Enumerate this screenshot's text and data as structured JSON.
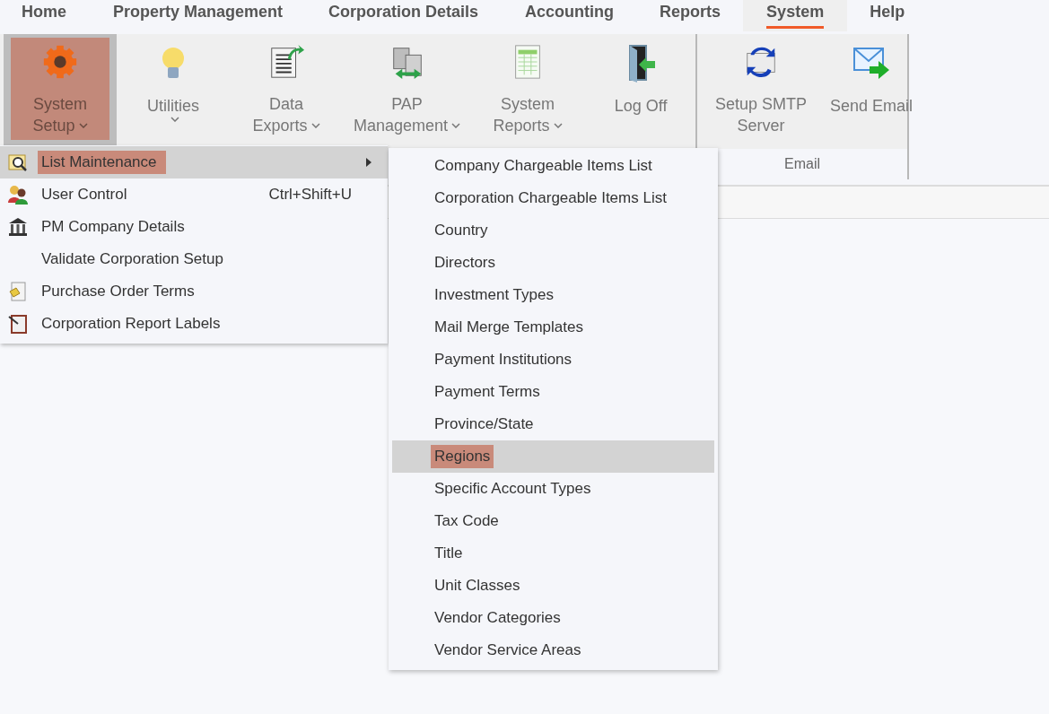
{
  "tabs": [
    {
      "label": "Home",
      "selected": false
    },
    {
      "label": "Property Management",
      "selected": false
    },
    {
      "label": "Corporation Details",
      "selected": false
    },
    {
      "label": "Accounting",
      "selected": false
    },
    {
      "label": "Reports",
      "selected": false
    },
    {
      "label": "System",
      "selected": true
    },
    {
      "label": "Help",
      "selected": false
    }
  ],
  "ribbon": {
    "groups": [
      {
        "buttons": [
          {
            "lines": [
              "System",
              "Setup"
            ],
            "dropdown": true,
            "selected": true
          },
          {
            "lines": [
              "Utilities"
            ],
            "dropdown": true,
            "selected": false
          },
          {
            "lines": [
              "Data",
              "Exports"
            ],
            "dropdown": true,
            "selected": false
          },
          {
            "lines": [
              "PAP",
              "Management"
            ],
            "dropdown": true,
            "selected": false
          },
          {
            "lines": [
              "System",
              "Reports"
            ],
            "dropdown": true,
            "selected": false
          },
          {
            "lines": [
              "Log Off"
            ],
            "dropdown": false,
            "selected": false
          }
        ]
      },
      {
        "label": "Email",
        "buttons": [
          {
            "lines": [
              "Setup SMTP",
              "Server"
            ],
            "dropdown": false,
            "selected": false
          },
          {
            "lines": [
              "Send Email"
            ],
            "dropdown": false,
            "selected": false
          }
        ]
      }
    ]
  },
  "menu": {
    "items": [
      {
        "label": "List Maintenance",
        "submenu": true,
        "selected": true
      },
      {
        "label": "User Control",
        "shortcut": "Ctrl+Shift+U",
        "submenu": false,
        "selected": false
      },
      {
        "label": "PM Company Details",
        "submenu": false,
        "selected": false
      },
      {
        "label": "Validate Corporation Setup",
        "submenu": false,
        "selected": false
      },
      {
        "label": "Purchase Order Terms",
        "submenu": false,
        "selected": false
      },
      {
        "label": "Corporation Report Labels",
        "submenu": false,
        "selected": false
      }
    ]
  },
  "submenu": {
    "items": [
      {
        "label": "Company Chargeable Items List",
        "selected": false
      },
      {
        "label": "Corporation Chargeable Items List",
        "selected": false
      },
      {
        "label": "Country",
        "selected": false
      },
      {
        "label": "Directors",
        "selected": false
      },
      {
        "label": "Investment Types",
        "selected": false
      },
      {
        "label": "Mail Merge Templates",
        "selected": false
      },
      {
        "label": "Payment Institutions",
        "selected": false
      },
      {
        "label": "Payment Terms",
        "selected": false
      },
      {
        "label": "Province/State",
        "selected": false
      },
      {
        "label": "Regions",
        "selected": true
      },
      {
        "label": "Specific Account Types",
        "selected": false
      },
      {
        "label": "Tax Code",
        "selected": false
      },
      {
        "label": "Title",
        "selected": false
      },
      {
        "label": "Unit Classes",
        "selected": false
      },
      {
        "label": "Vendor Categories",
        "selected": false
      },
      {
        "label": "Vendor Service Areas",
        "selected": false
      }
    ]
  }
}
